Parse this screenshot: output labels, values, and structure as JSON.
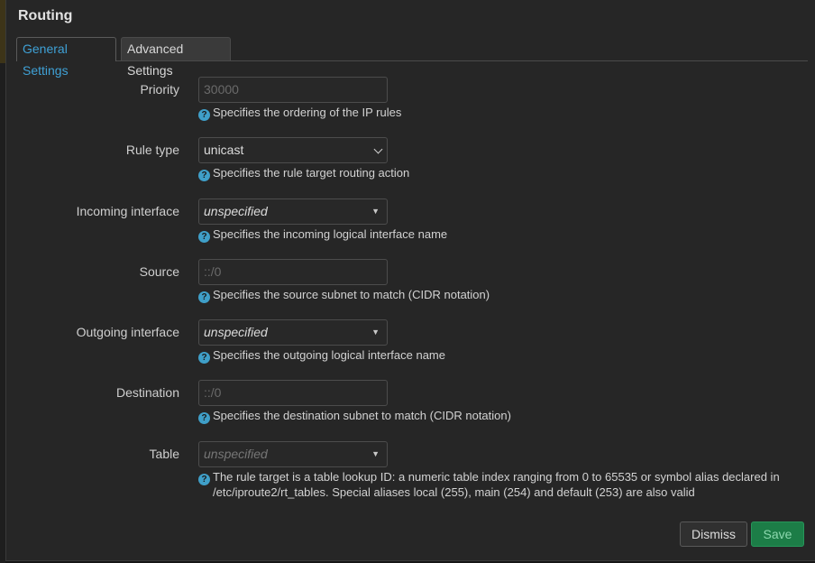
{
  "modal": {
    "title": "Routing",
    "tabs": [
      {
        "label": "General Settings",
        "active": true
      },
      {
        "label": "Advanced Settings",
        "active": false
      }
    ],
    "fields": {
      "priority": {
        "label": "Priority",
        "placeholder": "30000",
        "help": "Specifies the ordering of the IP rules"
      },
      "rule_type": {
        "label": "Rule type",
        "value": "unicast",
        "help": "Specifies the rule target routing action"
      },
      "incoming": {
        "label": "Incoming interface",
        "value": "unspecified",
        "help": "Specifies the incoming logical interface name"
      },
      "source": {
        "label": "Source",
        "placeholder": "::/0",
        "help": "Specifies the source subnet to match (CIDR notation)"
      },
      "outgoing": {
        "label": "Outgoing interface",
        "value": "unspecified",
        "help": "Specifies the outgoing logical interface name"
      },
      "destination": {
        "label": "Destination",
        "placeholder": "::/0",
        "help": "Specifies the destination subnet to match (CIDR notation)"
      },
      "table": {
        "label": "Table",
        "value": "unspecified",
        "help": "The rule target is a table lookup ID: a numeric table index ranging from 0 to 65535 or symbol alias declared in /etc/iproute2/rt_tables. Special aliases local (255), main (254) and default (253) are also valid"
      }
    },
    "buttons": {
      "dismiss": "Dismiss",
      "save": "Save"
    },
    "help_icon": "question-circle-icon",
    "colors": {
      "accent": "#3fa1d6",
      "save": "#1c7d47",
      "help_icon": "#3f9fc8"
    }
  }
}
